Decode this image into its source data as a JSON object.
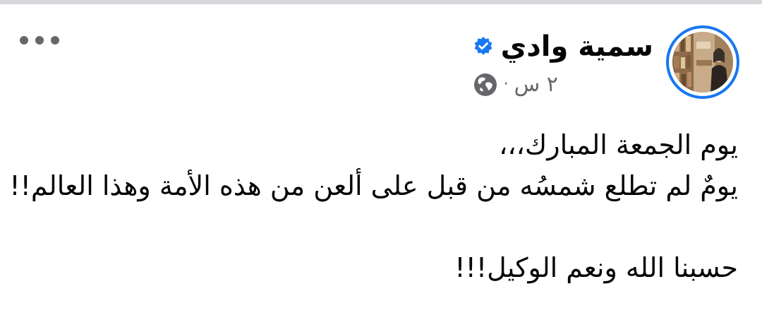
{
  "post": {
    "author_name": "سمية وادي",
    "verified_icon": "verified-badge-icon",
    "timestamp": "٢ س",
    "separator": "·",
    "audience_icon": "globe-icon",
    "more_icon": "more-options-icon",
    "lines": [
      "يوم الجمعة المبارك،،،",
      "يومٌ لم تطلع شمسُه من قبل على ألعن من هذه الأمة وهذا العالم!!",
      "",
      "حسبنا الله ونعم الوكيل!!!"
    ]
  },
  "colors": {
    "accent": "#1877f2",
    "text": "#050505",
    "secondary_text": "#65676b",
    "divider": "#d6d8dc"
  }
}
